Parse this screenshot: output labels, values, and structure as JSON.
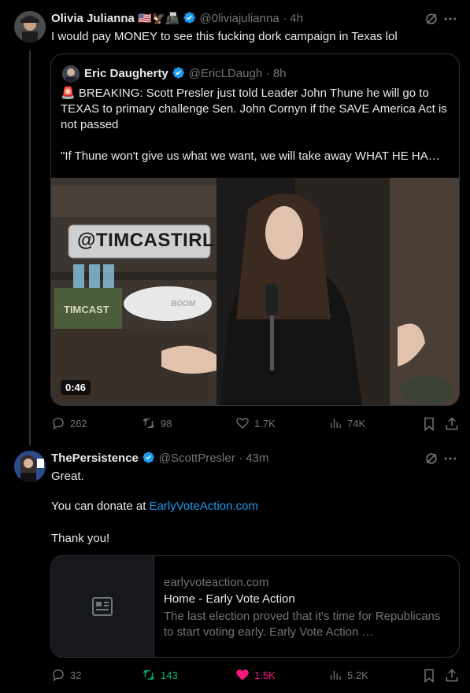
{
  "tweet1": {
    "name": "Olivia Julianna",
    "name_emoji": "🇺🇸🦅📠",
    "handle": "@0liviajulianna",
    "time": "· 4h",
    "text": "I would pay MONEY to see this fucking dork campaign in Texas lol",
    "quote": {
      "name": "Eric Daugherty",
      "handle": "@EricLDaugh",
      "time": "· 8h",
      "text_line1": "🚨 BREAKING: Scott Presler just told Leader John Thune he will go to TEXAS to primary challenge Sen. John Cornyn if the SAVE America Act is not passed",
      "text_line2": "\"If Thune won't give us what we want, we will take away WHAT HE HA…",
      "video_sign": "@TIMCASTIRL",
      "video_box_label": "TIMCAST",
      "video_pillow_label": "BOOM",
      "video_duration": "0:46"
    },
    "actions": {
      "replies": "262",
      "reposts": "98",
      "likes": "1.7K",
      "views": "74K"
    }
  },
  "tweet2": {
    "name": "ThePersistence",
    "handle": "@ScottPresler",
    "time": "· 43m",
    "text_line1": "Great.",
    "text_line2_prefix": "You can donate at ",
    "text_link": "EarlyVoteAction.com",
    "text_line3": "Thank you!",
    "card": {
      "domain": "earlyvoteaction.com",
      "title": "Home - Early Vote Action",
      "desc": "The last election proved that it's time for Republicans to start voting early. Early Vote Action …"
    },
    "actions": {
      "replies": "32",
      "reposts": "143",
      "likes": "1.5K",
      "views": "5.2K"
    }
  },
  "colors": {
    "accent": "#1d9bf0",
    "like": "#f91880",
    "repost": "#00ba7c",
    "muted": "#71767b"
  }
}
